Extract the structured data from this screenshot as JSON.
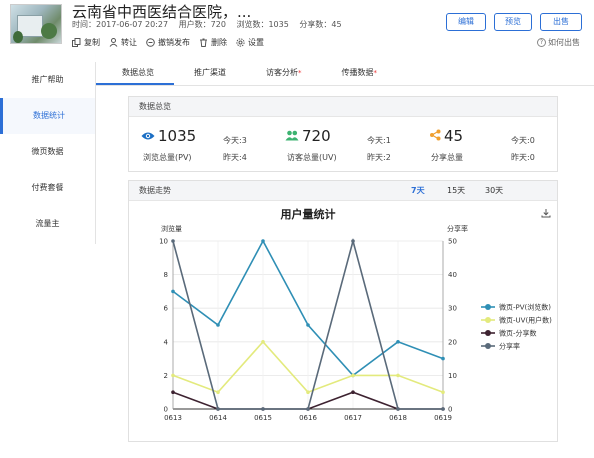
{
  "header": {
    "title": "云南省中西医结合医院，...",
    "time": "时间：2017-06-07 20:27",
    "users": "用户数：720",
    "views": "浏览数：1035",
    "shares": "分享数：45",
    "actions": {
      "copy": "复制",
      "transfer": "转让",
      "unpublish": "撤销发布",
      "delete": "删除",
      "settings": "设置"
    },
    "buttons": {
      "edit": "编辑",
      "preview": "预览",
      "sale": "出售"
    },
    "help": "如何出售"
  },
  "sidebar": {
    "items": [
      {
        "label": "推广帮助"
      },
      {
        "label": "数据统计"
      },
      {
        "label": "微页数据"
      },
      {
        "label": "付费套餐"
      },
      {
        "label": "流量主"
      }
    ]
  },
  "tabs": [
    {
      "label": "数据总览"
    },
    {
      "label": "推广渠道"
    },
    {
      "label": "访客分析"
    },
    {
      "label": "传播数据"
    }
  ],
  "overview": {
    "title": "数据总览",
    "stats": [
      {
        "icon": "eye-icon",
        "value": "1035",
        "label": "浏览总量(PV)",
        "today": "今天:3",
        "yesterday": "昨天:4",
        "color": "#1c6fc4"
      },
      {
        "icon": "users-icon",
        "value": "720",
        "label": "访客总量(UV)",
        "today": "今天:1",
        "yesterday": "昨天:2",
        "color": "#3cb371"
      },
      {
        "icon": "share-icon",
        "value": "45",
        "label": "分享总量",
        "today": "今天:0",
        "yesterday": "昨天:0",
        "color": "#f0a030"
      }
    ]
  },
  "trend": {
    "title": "数据走势",
    "ranges": [
      "7天",
      "15天",
      "30天"
    ],
    "active_range": "7天"
  },
  "chart_data": {
    "type": "line",
    "title": "用户量统计",
    "ylabel": "浏览量",
    "y2label": "分享率",
    "categories": [
      "0613",
      "0614",
      "0615",
      "0616",
      "0617",
      "0618",
      "0619"
    ],
    "ylim": [
      0,
      10
    ],
    "y2lim": [
      0,
      50
    ],
    "yticks": [
      "0",
      "2",
      "4",
      "6",
      "8",
      "10"
    ],
    "y2ticks": [
      "0",
      "10",
      "20",
      "30",
      "40",
      "50"
    ],
    "grid": true,
    "legend": "right",
    "series": [
      {
        "name": "微页-PV(浏览数)",
        "axis": "left",
        "color": "#2f8fb5",
        "values": [
          7,
          5,
          10,
          5,
          2,
          4,
          3
        ]
      },
      {
        "name": "微页-UV(用户数)",
        "axis": "left",
        "color": "#e3ea7d",
        "values": [
          2,
          1,
          4,
          1,
          2,
          2,
          1
        ]
      },
      {
        "name": "微页-分享数",
        "axis": "left",
        "color": "#3d2230",
        "values": [
          1,
          0,
          0,
          0,
          1,
          0,
          0
        ]
      },
      {
        "name": "分享率",
        "axis": "right",
        "color": "#5a6a7a",
        "values": [
          50,
          0,
          0,
          0,
          50,
          0,
          0
        ]
      }
    ]
  }
}
